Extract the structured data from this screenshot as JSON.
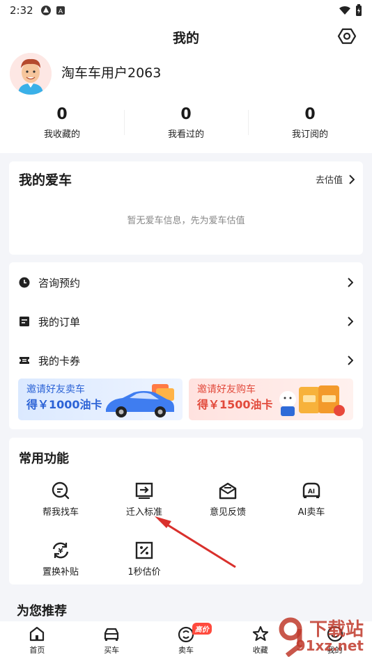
{
  "status": {
    "time": "2:32"
  },
  "header": {
    "title": "我的",
    "username": "淘车车用户2063"
  },
  "stats": [
    {
      "num": "0",
      "label": "我收藏的"
    },
    {
      "num": "0",
      "label": "我看过的"
    },
    {
      "num": "0",
      "label": "我订阅的"
    }
  ],
  "my_car": {
    "title": "我的爱车",
    "link": "去估值",
    "empty": "暂无爱车信息，先为爱车估值"
  },
  "menu": [
    {
      "label": "咨询预约",
      "icon": "clock-icon"
    },
    {
      "label": "我的订单",
      "icon": "order-icon"
    },
    {
      "label": "我的卡券",
      "icon": "ticket-icon"
    }
  ],
  "banners": {
    "sell": {
      "line1": "邀请好友卖车",
      "line2": "得￥1000油卡"
    },
    "buy": {
      "line1": "邀请好友购车",
      "line2": "得￥1500油卡"
    }
  },
  "functions": {
    "title": "常用功能",
    "items": [
      "帮我找车",
      "迁入标准",
      "意见反馈",
      "AI卖车",
      "置换补贴",
      "1秒估价"
    ]
  },
  "recommend": "为您推荐",
  "tabs": [
    {
      "label": "首页"
    },
    {
      "label": "买车"
    },
    {
      "label": "卖车",
      "badge": "高价"
    },
    {
      "label": "收藏"
    },
    {
      "label": "我的"
    }
  ],
  "watermark": {
    "text1": "下载站",
    "text2": "91xz.net"
  },
  "colors": {
    "accent_blue": "#2c63d6",
    "accent_red": "#e24a3c",
    "badge_red": "#ff4a3d",
    "annotation_red": "#d9302c"
  }
}
